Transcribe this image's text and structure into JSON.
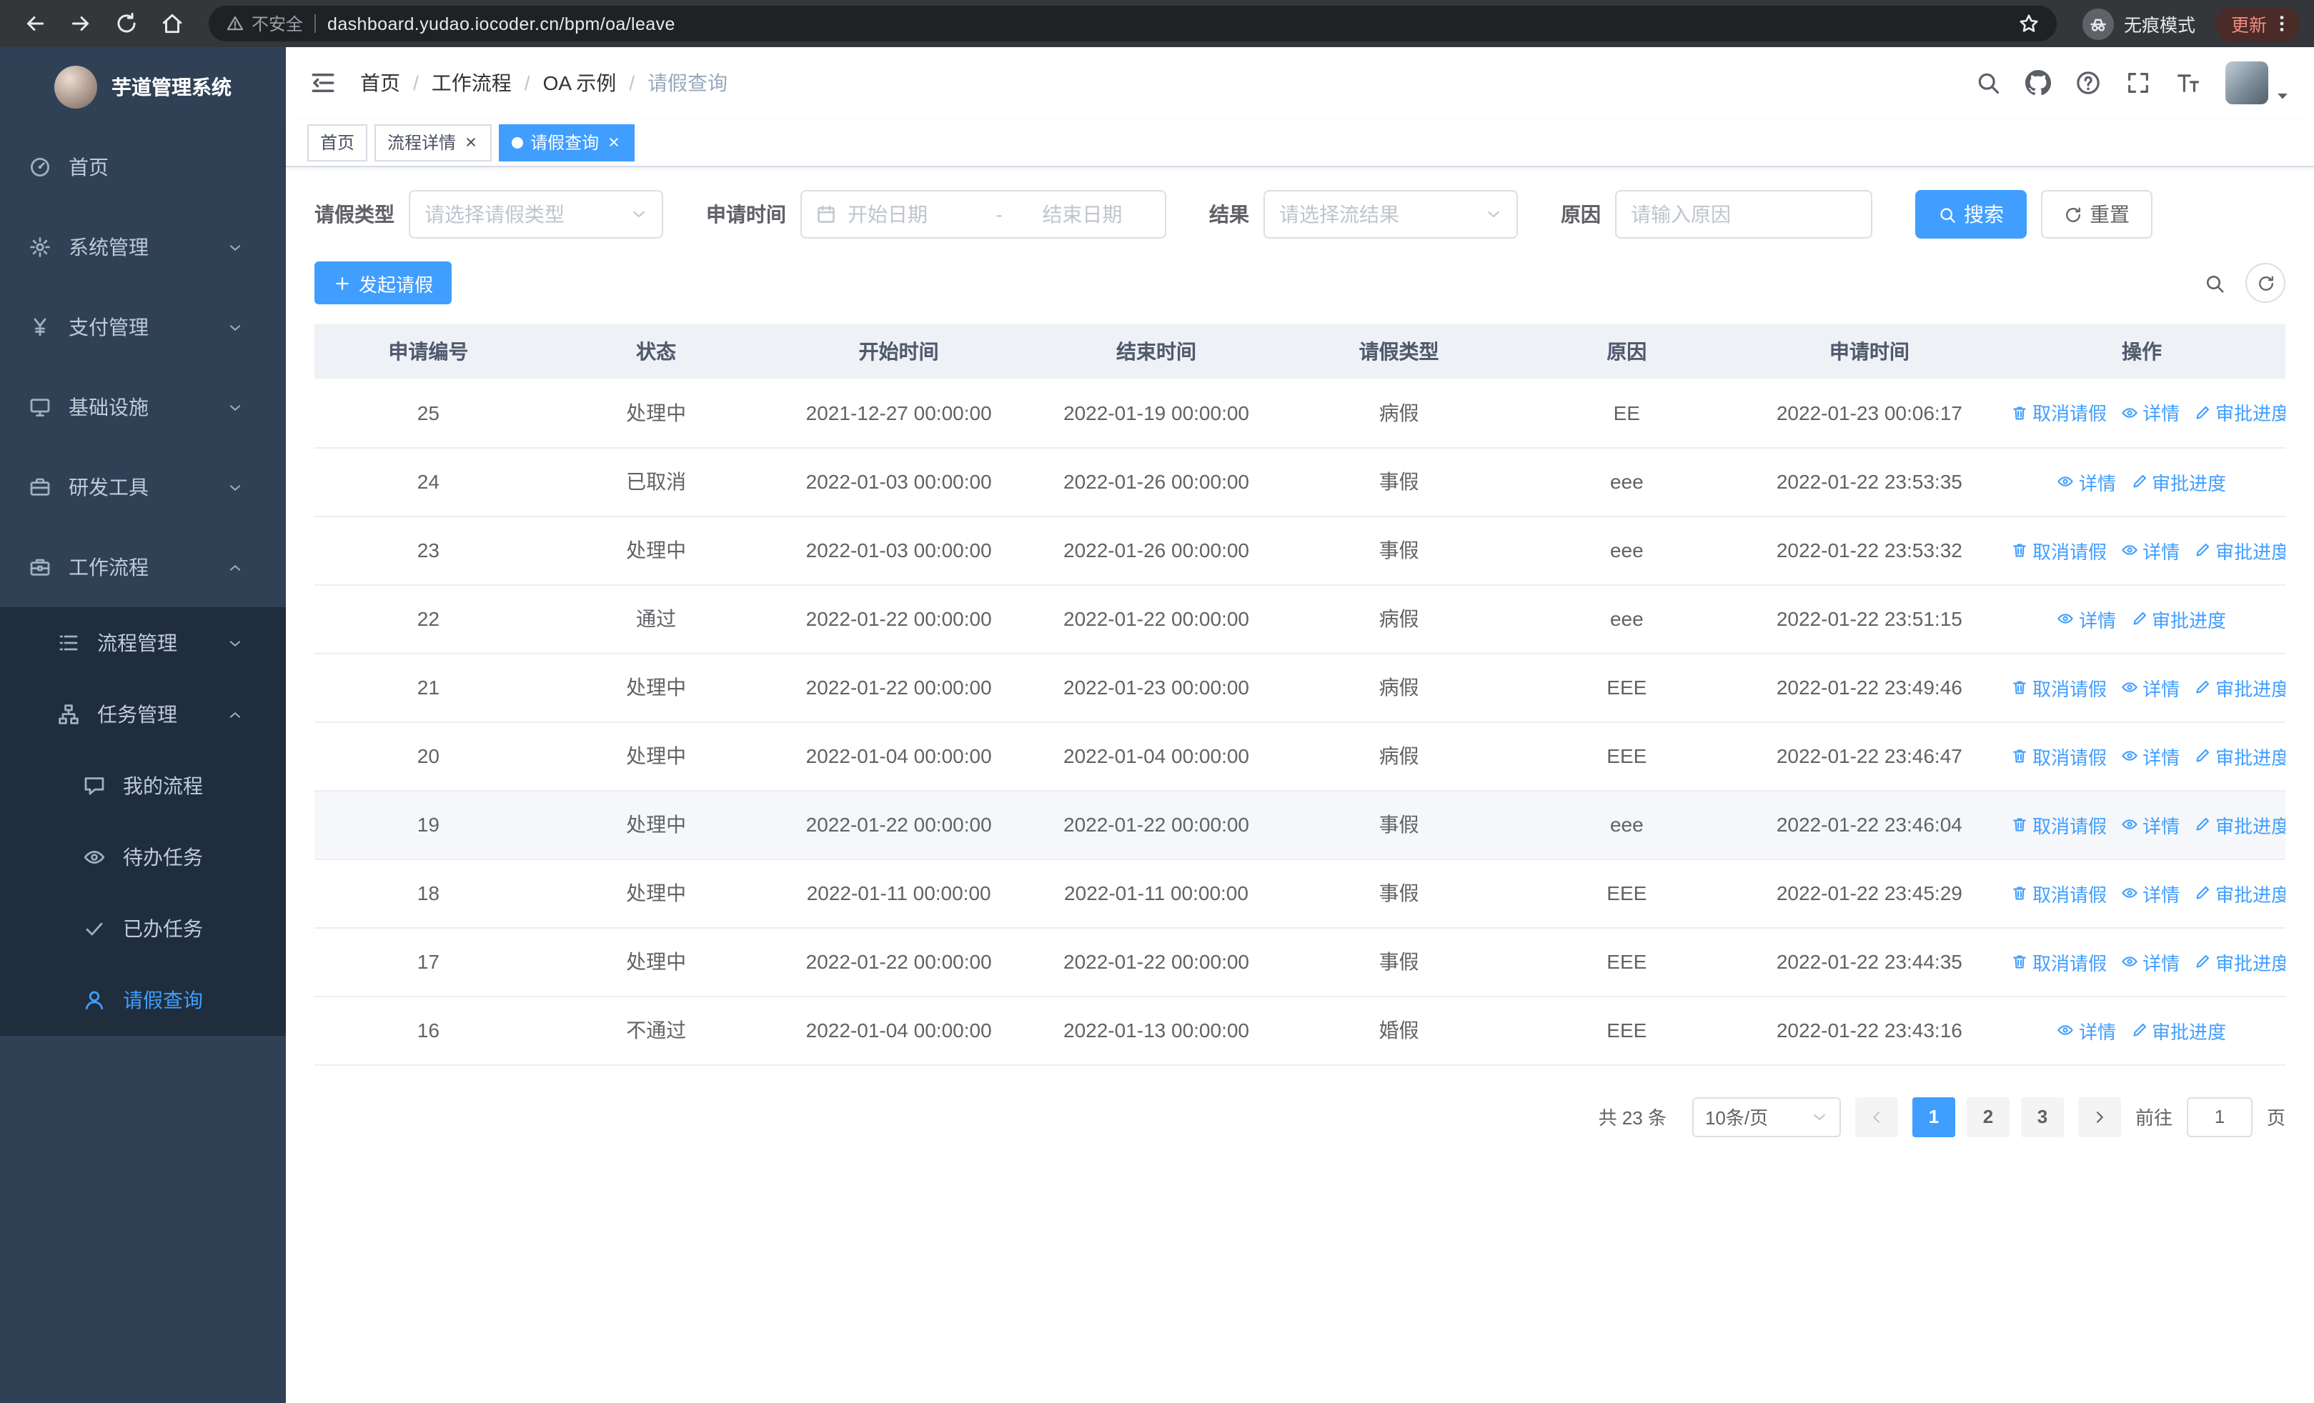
{
  "browser": {
    "security_label": "不安全",
    "url": "dashboard.yudao.iocoder.cn/bpm/oa/leave",
    "incognito_label": "无痕模式",
    "update_label": "更新"
  },
  "sidebar": {
    "logo_title": "芋道管理系统",
    "items": [
      {
        "key": "home",
        "label": "首页",
        "icon": "dashboard"
      },
      {
        "key": "system",
        "label": "系统管理",
        "icon": "gear",
        "expandable": true
      },
      {
        "key": "payment",
        "label": "支付管理",
        "icon": "yen",
        "expandable": true
      },
      {
        "key": "infrastructure",
        "label": "基础设施",
        "icon": "monitor",
        "expandable": true
      },
      {
        "key": "dev-tools",
        "label": "研发工具",
        "icon": "toolbox",
        "expandable": true
      },
      {
        "key": "workflow",
        "label": "工作流程",
        "icon": "briefcase",
        "expandable": true,
        "expanded": true
      }
    ],
    "workflow_children": [
      {
        "key": "process-mgmt",
        "label": "流程管理",
        "icon": "list-tree",
        "expandable": true
      },
      {
        "key": "task-mgmt",
        "label": "任务管理",
        "icon": "org",
        "expandable": true,
        "expanded": true
      }
    ],
    "task_children": [
      {
        "key": "my-process",
        "label": "我的流程",
        "icon": "chat"
      },
      {
        "key": "todo-tasks",
        "label": "待办任务",
        "icon": "eye"
      },
      {
        "key": "done-tasks",
        "label": "已办任务",
        "icon": "check"
      },
      {
        "key": "leave-query",
        "label": "请假查询",
        "icon": "user",
        "active": true
      }
    ]
  },
  "navbar": {
    "breadcrumbs": [
      "首页",
      "工作流程",
      "OA 示例",
      "请假查询"
    ]
  },
  "tabs": [
    {
      "label": "首页",
      "closable": false,
      "active": false
    },
    {
      "label": "流程详情",
      "closable": true,
      "active": false
    },
    {
      "label": "请假查询",
      "closable": true,
      "active": true
    }
  ],
  "filters": {
    "leave_type_label": "请假类型",
    "leave_type_placeholder": "请选择请假类型",
    "apply_time_label": "申请时间",
    "date_start_placeholder": "开始日期",
    "date_separator": "-",
    "date_end_placeholder": "结束日期",
    "result_label": "结果",
    "result_placeholder": "请选择流结果",
    "reason_label": "原因",
    "reason_placeholder": "请输入原因",
    "search_label": "搜索",
    "reset_label": "重置"
  },
  "toolbar": {
    "create_label": "发起请假"
  },
  "table": {
    "columns": [
      "申请编号",
      "状态",
      "开始时间",
      "结束时间",
      "请假类型",
      "原因",
      "申请时间",
      "操作"
    ],
    "action_cancel": "取消请假",
    "action_detail": "详情",
    "action_progress": "审批进度",
    "rows": [
      {
        "id": "25",
        "status": "处理中",
        "start": "2021-12-27 00:00:00",
        "end": "2022-01-19 00:00:00",
        "type": "病假",
        "reason": "EE",
        "applied": "2022-01-23 00:06:17",
        "cancellable": true
      },
      {
        "id": "24",
        "status": "已取消",
        "start": "2022-01-03 00:00:00",
        "end": "2022-01-26 00:00:00",
        "type": "事假",
        "reason": "eee",
        "applied": "2022-01-22 23:53:35",
        "cancellable": false
      },
      {
        "id": "23",
        "status": "处理中",
        "start": "2022-01-03 00:00:00",
        "end": "2022-01-26 00:00:00",
        "type": "事假",
        "reason": "eee",
        "applied": "2022-01-22 23:53:32",
        "cancellable": true
      },
      {
        "id": "22",
        "status": "通过",
        "start": "2022-01-22 00:00:00",
        "end": "2022-01-22 00:00:00",
        "type": "病假",
        "reason": "eee",
        "applied": "2022-01-22 23:51:15",
        "cancellable": false
      },
      {
        "id": "21",
        "status": "处理中",
        "start": "2022-01-22 00:00:00",
        "end": "2022-01-23 00:00:00",
        "type": "病假",
        "reason": "EEE",
        "applied": "2022-01-22 23:49:46",
        "cancellable": true
      },
      {
        "id": "20",
        "status": "处理中",
        "start": "2022-01-04 00:00:00",
        "end": "2022-01-04 00:00:00",
        "type": "病假",
        "reason": "EEE",
        "applied": "2022-01-22 23:46:47",
        "cancellable": true
      },
      {
        "id": "19",
        "status": "处理中",
        "start": "2022-01-22 00:00:00",
        "end": "2022-01-22 00:00:00",
        "type": "事假",
        "reason": "eee",
        "applied": "2022-01-22 23:46:04",
        "cancellable": true,
        "hover": true
      },
      {
        "id": "18",
        "status": "处理中",
        "start": "2022-01-11 00:00:00",
        "end": "2022-01-11 00:00:00",
        "type": "事假",
        "reason": "EEE",
        "applied": "2022-01-22 23:45:29",
        "cancellable": true
      },
      {
        "id": "17",
        "status": "处理中",
        "start": "2022-01-22 00:00:00",
        "end": "2022-01-22 00:00:00",
        "type": "事假",
        "reason": "EEE",
        "applied": "2022-01-22 23:44:35",
        "cancellable": true
      },
      {
        "id": "16",
        "status": "不通过",
        "start": "2022-01-04 00:00:00",
        "end": "2022-01-13 00:00:00",
        "type": "婚假",
        "reason": "EEE",
        "applied": "2022-01-22 23:43:16",
        "cancellable": false
      }
    ]
  },
  "pagination": {
    "total_label": "共 23 条",
    "page_size": "10条/页",
    "pages": [
      "1",
      "2",
      "3"
    ],
    "active_page": "1",
    "goto_label": "前往",
    "goto_value": "1",
    "goto_suffix": "页"
  },
  "colors": {
    "primary": "#409eff",
    "sidebar_bg": "#304156",
    "submenu_bg": "#1f2d3d",
    "table_header_bg": "#eef1f6"
  }
}
